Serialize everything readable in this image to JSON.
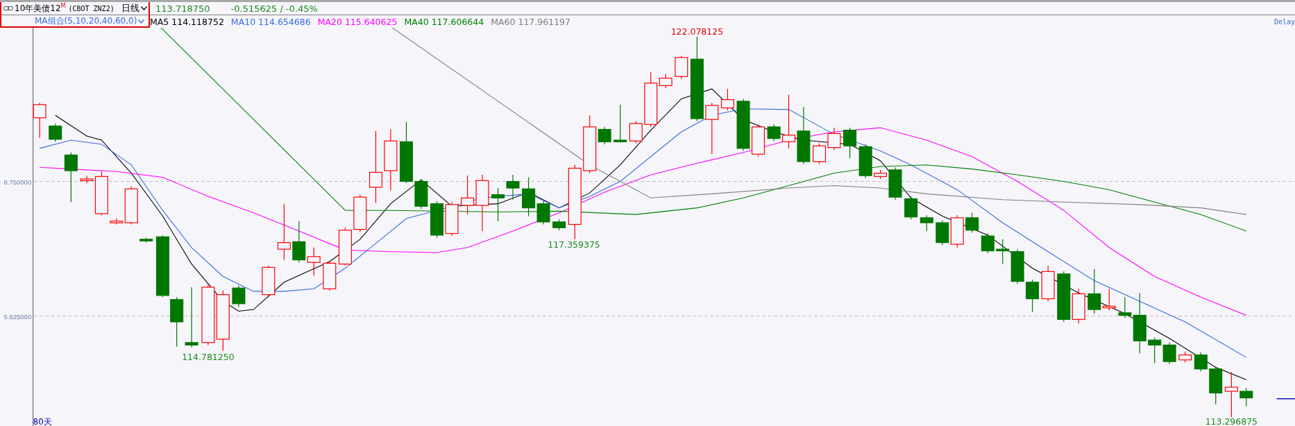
{
  "symbol": {
    "name": "10年美债12$^{M}$",
    "code": "(CBOT ZNZ2)"
  },
  "period": {
    "label": "日线"
  },
  "quote": {
    "price": "113.718750",
    "change": "-0.515625 / -0.45%"
  },
  "ma_group": {
    "label": "MA组合(5,10,20,40,60,0)"
  },
  "ma_legend": [
    {
      "label": "MA5",
      "value": "114.118752",
      "color": "#000000"
    },
    {
      "label": "MA10",
      "value": "114.654686",
      "color": "#3a6ae0"
    },
    {
      "label": "MA20",
      "value": "115.640625",
      "color": "#ff00ff"
    },
    {
      "label": "MA40",
      "value": "117.606644",
      "color": "#008000"
    },
    {
      "label": "MA60",
      "value": "117.961197",
      "color": "#808080"
    }
  ],
  "delay_label": "Delay",
  "y_axis": [
    "8.750000",
    "5.625000"
  ],
  "price_labels": [
    {
      "text": "122.078125",
      "kind": "high"
    },
    {
      "text": "117.359375",
      "kind": "low"
    },
    {
      "text": "114.781250",
      "kind": "low"
    },
    {
      "text": "113.296875",
      "kind": "low"
    }
  ],
  "period_count": "80天"
}
